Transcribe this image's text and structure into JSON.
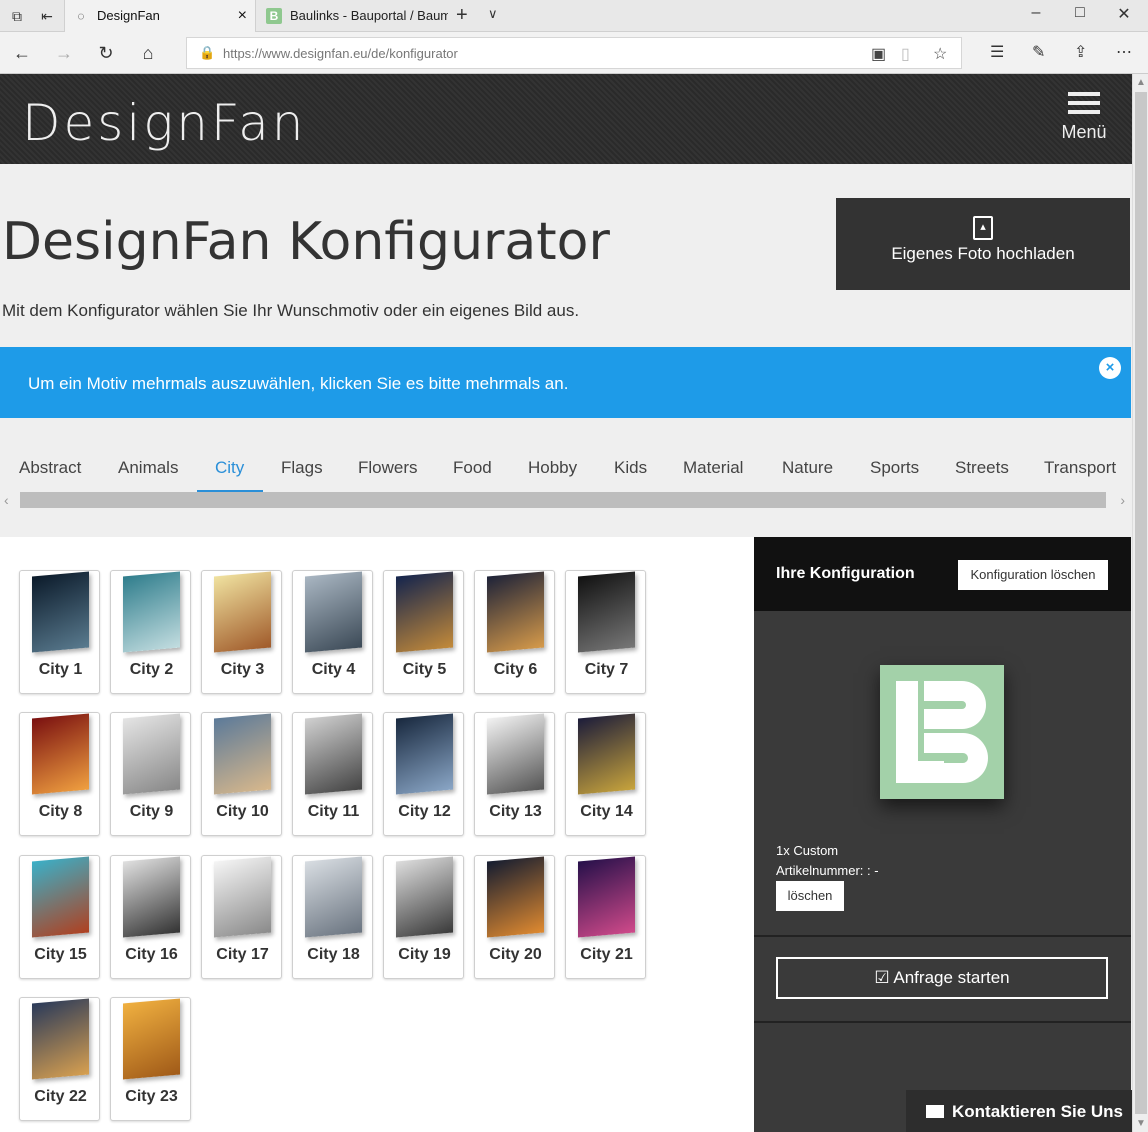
{
  "browser": {
    "tabs": [
      {
        "title": "DesignFan",
        "active": true
      },
      {
        "title": "Baulinks - Bauportal / Baum",
        "active": false,
        "favicon_letter": "B"
      }
    ],
    "url": {
      "domain": "https://www.designfan.eu",
      "path": "/de/konfigurator"
    }
  },
  "header": {
    "logo": "DesignFan",
    "menu_label": "Menü"
  },
  "page": {
    "title": "DesignFan Konfigurator",
    "subtitle": "Mit dem Konfigurator wählen Sie Ihr Wunschmotiv oder ein eigenes Bild aus.",
    "upload_label": "Eigenes Foto hochladen",
    "info_message": "Um ein Motiv mehrmals auszuwählen, klicken Sie es bitte mehrmals an.",
    "info_close": "×"
  },
  "categories": [
    "Abstract",
    "Animals",
    "City",
    "Flags",
    "Flowers",
    "Food",
    "Hobby",
    "Kids",
    "Material",
    "Nature",
    "Sports",
    "Streets",
    "Transport"
  ],
  "active_category": "City",
  "motifs": [
    {
      "label": "City 1",
      "colors": [
        "#0b1a2a",
        "#5a7b8f"
      ]
    },
    {
      "label": "City 2",
      "colors": [
        "#2f7d8c",
        "#c3dde0"
      ]
    },
    {
      "label": "City 3",
      "colors": [
        "#f0e2a0",
        "#a05a2a"
      ]
    },
    {
      "label": "City 4",
      "colors": [
        "#a9b6c2",
        "#3c4a57"
      ]
    },
    {
      "label": "City 5",
      "colors": [
        "#14244d",
        "#c38a3a"
      ]
    },
    {
      "label": "City 6",
      "colors": [
        "#1d2238",
        "#d69a4a"
      ]
    },
    {
      "label": "City 7",
      "colors": [
        "#111111",
        "#777777"
      ]
    },
    {
      "label": "City 8",
      "colors": [
        "#7a1010",
        "#f0a040"
      ]
    },
    {
      "label": "City 9",
      "colors": [
        "#e4e4e4",
        "#888888"
      ]
    },
    {
      "label": "City 10",
      "colors": [
        "#5c7a99",
        "#d8b88c"
      ]
    },
    {
      "label": "City 11",
      "colors": [
        "#d0d0d0",
        "#444444"
      ]
    },
    {
      "label": "City 12",
      "colors": [
        "#18283e",
        "#8aa6c6"
      ]
    },
    {
      "label": "City 13",
      "colors": [
        "#f2f2f2",
        "#555555"
      ]
    },
    {
      "label": "City 14",
      "colors": [
        "#1c1c3a",
        "#c8a43c"
      ]
    },
    {
      "label": "City 15",
      "colors": [
        "#3ab0c8",
        "#b04020"
      ]
    },
    {
      "label": "City 16",
      "colors": [
        "#e0e0e0",
        "#333333"
      ]
    },
    {
      "label": "City 17",
      "colors": [
        "#f5f5f5",
        "#8a8a8a"
      ]
    },
    {
      "label": "City 18",
      "colors": [
        "#d8dde2",
        "#6a7480"
      ]
    },
    {
      "label": "City 19",
      "colors": [
        "#dddddd",
        "#3a3a3a"
      ]
    },
    {
      "label": "City 20",
      "colors": [
        "#141c30",
        "#e08a30"
      ]
    },
    {
      "label": "City 21",
      "colors": [
        "#26104a",
        "#d04a8a"
      ]
    },
    {
      "label": "City 22",
      "colors": [
        "#2a3a5a",
        "#d8a050"
      ]
    },
    {
      "label": "City 23",
      "colors": [
        "#f0b040",
        "#a05a18"
      ]
    }
  ],
  "config": {
    "title": "Ihre Konfiguration",
    "clear_label": "Konfiguration löschen",
    "item_line": "1x Custom",
    "article_line": "Artikelnummer: : -",
    "delete_label": "löschen",
    "request_label": "Anfrage starten",
    "image_bg": "#a3d1a9"
  },
  "contact_label": "Kontaktieren Sie Uns",
  "colors": {
    "accent": "#1e9be8",
    "tab_active": "#2a8fd8",
    "dark": "#333333"
  }
}
